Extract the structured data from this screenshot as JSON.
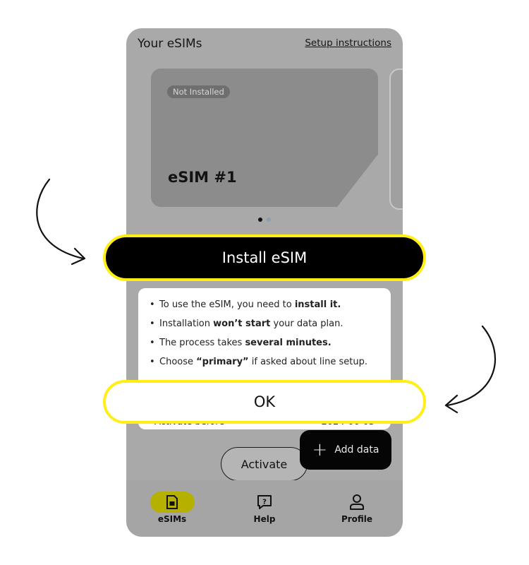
{
  "header": {
    "title": "Your eSIMs",
    "setup_link": "Setup instructions"
  },
  "card": {
    "status_badge": "Not Installed",
    "name": "eSIM #1"
  },
  "carousel": {
    "count": 2,
    "active_index": 0
  },
  "install_button": {
    "label": "Install eSIM"
  },
  "info": {
    "items": [
      {
        "pre": "To use the eSIM, you need to ",
        "bold": "install it.",
        "post": ""
      },
      {
        "pre": "Installation ",
        "bold": "won’t start",
        "post": " your data plan."
      },
      {
        "pre": "The process takes ",
        "bold": "several minutes.",
        "post": ""
      },
      {
        "pre": "Choose ",
        "bold": "“primary”",
        "post": " if asked about line setup."
      }
    ]
  },
  "activate_row": {
    "label": "Activate before",
    "value": "2024-06-03"
  },
  "activate_button": {
    "label": "Activate"
  },
  "add_data_button": {
    "label": "Add data",
    "icon": "plus-icon"
  },
  "ok_button": {
    "label": "OK"
  },
  "bottom_nav": {
    "items": [
      {
        "label": "eSIMs",
        "icon": "sim-card-icon",
        "active": true
      },
      {
        "label": "Help",
        "icon": "help-chat-icon",
        "active": false
      },
      {
        "label": "Profile",
        "icon": "person-icon",
        "active": false
      }
    ]
  },
  "colors": {
    "highlight_border": "#ffef16",
    "active_nav_pill": "#b6b000",
    "overlay_dim": "#a9a9a9"
  }
}
